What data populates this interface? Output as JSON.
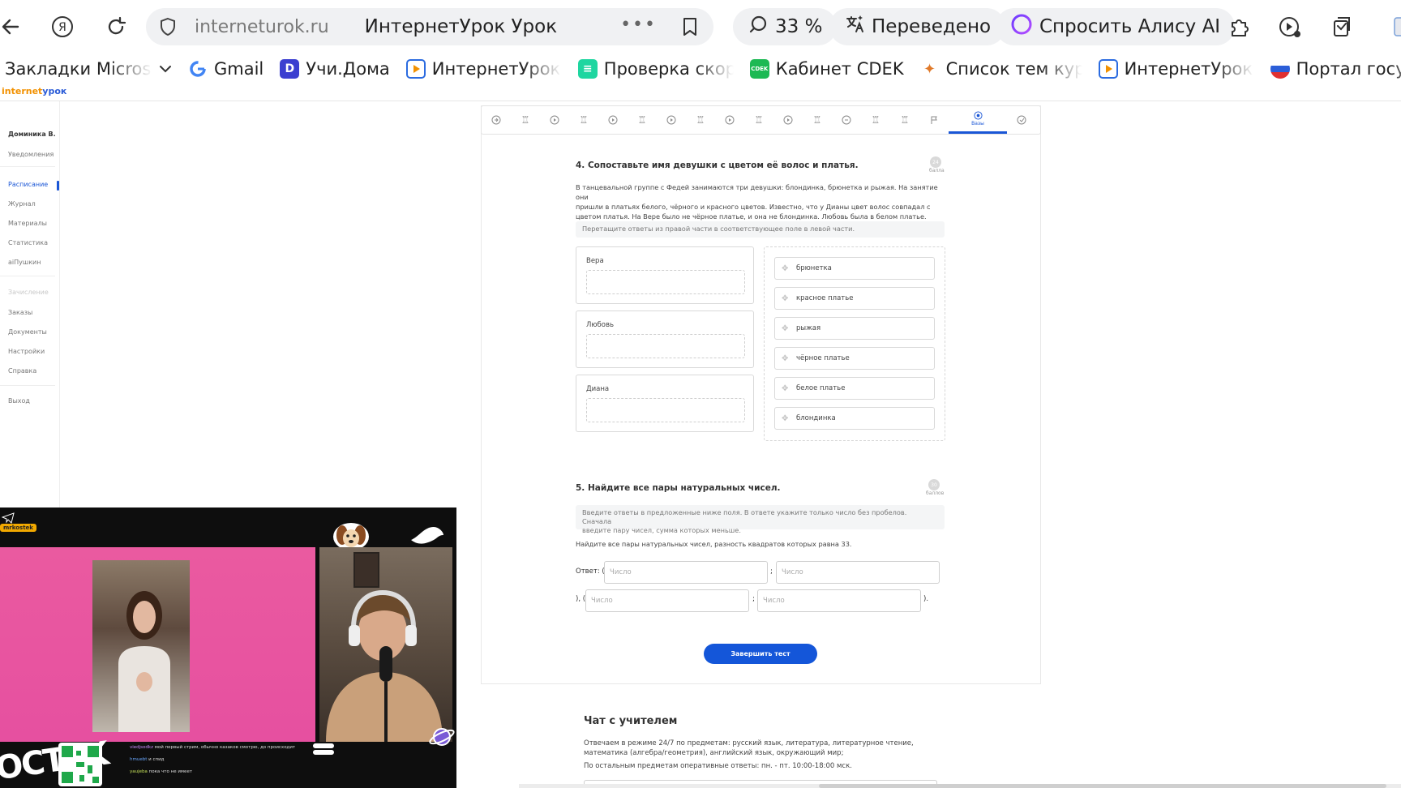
{
  "browser": {
    "domain": "interneturok.ru",
    "page_title": "ИнтернетУрок Урок",
    "zoom": "33 %",
    "translated_label": "Переведено",
    "alice_label": "Спросить Алису AI",
    "icons": [
      "back-icon",
      "yandex-icon",
      "reload-icon",
      "shield-icon",
      "more-icon",
      "bookmark-icon",
      "search-zoom-icon",
      "translate-icon",
      "alice-icon",
      "extensions-icon",
      "media-icon",
      "collections-icon"
    ]
  },
  "bookmarks": [
    {
      "label": "Закладки Microsoft E",
      "icon": "folder-icon"
    },
    {
      "label": "Gmail",
      "icon": "google-icon"
    },
    {
      "label": "Учи.Дома",
      "icon": "uchi-icon"
    },
    {
      "label": "ИнтернетУрок Ра",
      "icon": "play-icon"
    },
    {
      "label": "Проверка скорос",
      "icon": "speedtest-icon"
    },
    {
      "label": "Кабинет CDEK",
      "icon": "cdek-icon"
    },
    {
      "label": "Список тем курса",
      "icon": "list-icon"
    },
    {
      "label": "ИнтернетУрок Ра",
      "icon": "play-icon"
    },
    {
      "label": "Портал государст",
      "icon": "gosuslugi-icon"
    }
  ],
  "site": {
    "logo_part1": "internet",
    "logo_part2": "урок"
  },
  "sidebar": {
    "user": "Доминика В.",
    "notifications": "Уведомления",
    "items": [
      {
        "label": "Расписание",
        "active": true
      },
      {
        "label": "Журнал"
      },
      {
        "label": "Материалы"
      },
      {
        "label": "Статистика"
      },
      {
        "label": "aiПушкин"
      }
    ],
    "group2_title": "Зачисление",
    "items2": [
      {
        "label": "Заказы"
      },
      {
        "label": "Документы"
      },
      {
        "label": "Настройки"
      },
      {
        "label": "Справка"
      }
    ],
    "logout": "Выход"
  },
  "stepnav": {
    "active_label": "Вазы"
  },
  "question4": {
    "title": "4. Сопоставьте имя девушки с цветом её волос и платья.",
    "points": "24",
    "points_label": "балла",
    "text_line1": "В танцевальной группе с Федей занимаются три девушки: блондинка, брюнетка и рыжая. На занятие они",
    "text_line2": "пришли в платьях белого, чёрного и красного цветов. Известно, что у Дианы цвет волос совпадал с",
    "text_line3": "цветом платья. На Вере было не чёрное платье, и она не блондинка. Любовь была в белом платье.",
    "hint": "Перетащите ответы из правой части в соответствующее поле в левой части.",
    "targets": [
      "Вера",
      "Любовь",
      "Диана"
    ],
    "answers": [
      "брюнетка",
      "красное платье",
      "рыжая",
      "чёрное платье",
      "белое платье",
      "блондинка"
    ]
  },
  "question5": {
    "title": "5. Найдите все пары натуральных чисел.",
    "points": "30",
    "points_label": "баллов",
    "hint_line1": "Введите ответы в предложенные ниже поля. В ответе укажите только число без пробелов. Сначала",
    "hint_line2": "введите пару чисел, сумма которых меньше.",
    "text": "Найдите все пары натуральных чисел, разность квадратов которых равна 33.",
    "answer_prefix": "Ответ: (",
    "separator": ";",
    "mid_text": "), (",
    "end_text": ").",
    "placeholder": "Число"
  },
  "finish_button": "Завершить тест",
  "chat": {
    "title": "Чат с учителем",
    "line1": "Отвечаем в режиме 24/7 по предметам: русский язык, литература, литературное чтение,",
    "line2": "математика (алгебра/геометрия), английский язык, окружающий мир;",
    "line3": "По остальным предметам оперативные ответы: пн. - пт. 10:00-18:00 мск."
  },
  "stream": {
    "tag": "mrkostek",
    "brand": "OCTEK",
    "messages": [
      {
        "user": "viedjsodkz",
        "text": "мой первый стрим, обычно казаков смотрю, до происходит"
      },
      {
        "user": "hmuebt",
        "text": "и спид"
      },
      {
        "user": "yaujeba",
        "text": "пока что не имеет"
      }
    ]
  }
}
